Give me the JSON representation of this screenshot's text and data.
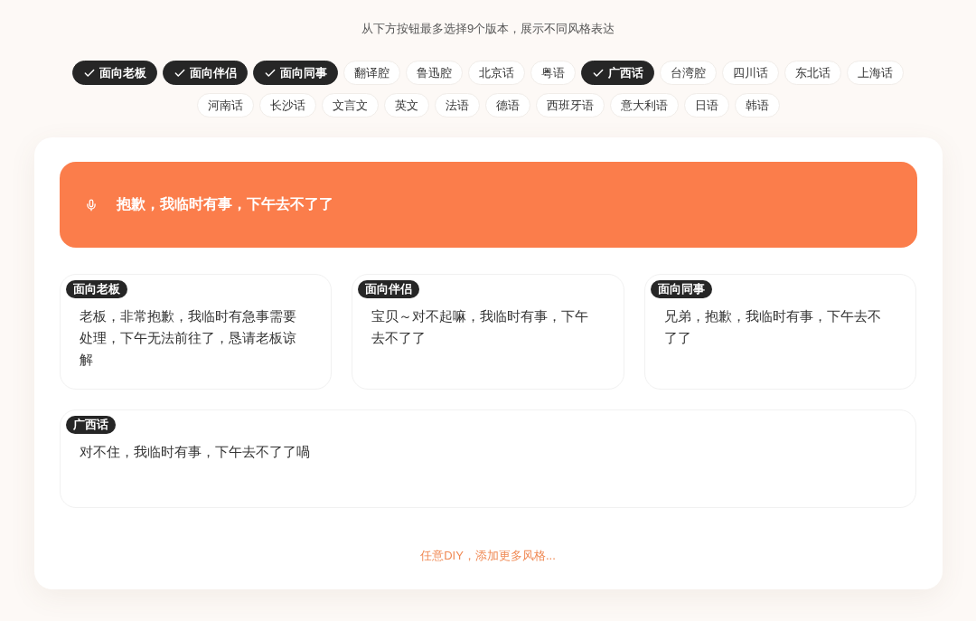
{
  "instruction": "从下方按钮最多选择9个版本，展示不同风格表达",
  "styles": [
    {
      "label": "面向老板",
      "selected": true
    },
    {
      "label": "面向伴侣",
      "selected": true
    },
    {
      "label": "面向同事",
      "selected": true
    },
    {
      "label": "翻译腔",
      "selected": false
    },
    {
      "label": "鲁迅腔",
      "selected": false
    },
    {
      "label": "北京话",
      "selected": false
    },
    {
      "label": "粤语",
      "selected": false
    },
    {
      "label": "广西话",
      "selected": true
    },
    {
      "label": "台湾腔",
      "selected": false
    },
    {
      "label": "四川话",
      "selected": false
    },
    {
      "label": "东北话",
      "selected": false
    },
    {
      "label": "上海话",
      "selected": false
    },
    {
      "label": "河南话",
      "selected": false
    },
    {
      "label": "长沙话",
      "selected": false
    },
    {
      "label": "文言文",
      "selected": false
    },
    {
      "label": "英文",
      "selected": false
    },
    {
      "label": "法语",
      "selected": false
    },
    {
      "label": "德语",
      "selected": false
    },
    {
      "label": "西班牙语",
      "selected": false
    },
    {
      "label": "意大利语",
      "selected": false
    },
    {
      "label": "日语",
      "selected": false
    },
    {
      "label": "韩语",
      "selected": false
    }
  ],
  "input": {
    "text": "抱歉，我临时有事，下午去不了了"
  },
  "results": [
    {
      "kind": "narrow",
      "tag": "面向老板",
      "text": "老板，非常抱歉，我临时有急事需要处理，下午无法前往了，恳请老板谅解"
    },
    {
      "kind": "narrow",
      "tag": "面向伴侣",
      "text": "宝贝～对不起嘛，我临时有事，下午去不了了"
    },
    {
      "kind": "narrow",
      "tag": "面向同事",
      "text": "兄弟，抱歉，我临时有事，下午去不了了"
    },
    {
      "kind": "wide",
      "tag": "广西话",
      "text": "对不住，我临时有事，下午去不了了喎"
    }
  ],
  "footer_link": "任意DIY，添加更多风格..."
}
